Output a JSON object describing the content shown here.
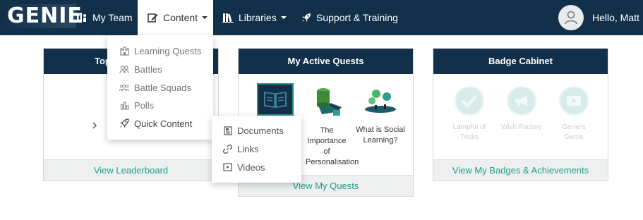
{
  "header": {
    "logo": "GENIE",
    "nav": [
      {
        "label": "My Team",
        "icon": "team-icon"
      },
      {
        "label": "Content",
        "icon": "edit-icon"
      },
      {
        "label": "Libraries",
        "icon": "books-icon"
      },
      {
        "label": "Support & Training",
        "icon": "rocket-icon"
      }
    ],
    "greeting": "Hello, Matt"
  },
  "content_menu": {
    "items": [
      {
        "label": "Learning Quests",
        "icon": "castle-icon"
      },
      {
        "label": "Battles",
        "icon": "users-icon"
      },
      {
        "label": "Battle Squads",
        "icon": "group-icon"
      },
      {
        "label": "Polls",
        "icon": "bar-chart-icon"
      },
      {
        "label": "Quick Content",
        "icon": "rocket-icon"
      }
    ],
    "quick_content_submenu": [
      {
        "label": "Documents",
        "icon": "document-icon"
      },
      {
        "label": "Links",
        "icon": "link-icon"
      },
      {
        "label": "Videos",
        "icon": "video-icon"
      }
    ]
  },
  "panels": {
    "leaderboard": {
      "title": "Top",
      "footer": "View Leaderboard"
    },
    "quests": {
      "title": "My Active Quests",
      "items": [
        {
          "title": "",
          "icon": "book-icon"
        },
        {
          "title": "The Importance of Personalisation",
          "icon": "personalisation-icon"
        },
        {
          "title": "What is Social Learning?",
          "icon": "social-learning-icon"
        }
      ],
      "footer": "View My Quests"
    },
    "badges": {
      "title": "Badge Cabinet",
      "items": [
        {
          "title": "Lampful of Tricks",
          "icon": "check-icon"
        },
        {
          "title": "Wish Factory",
          "icon": "megaphone-icon"
        },
        {
          "title": "Genie's Gems",
          "icon": "video-play-icon"
        }
      ],
      "footer": "View My Badges & Achievements"
    }
  },
  "colors": {
    "navy": "#13304b",
    "teal": "#1f9e8a",
    "badge_muted": "#d7ecea"
  }
}
